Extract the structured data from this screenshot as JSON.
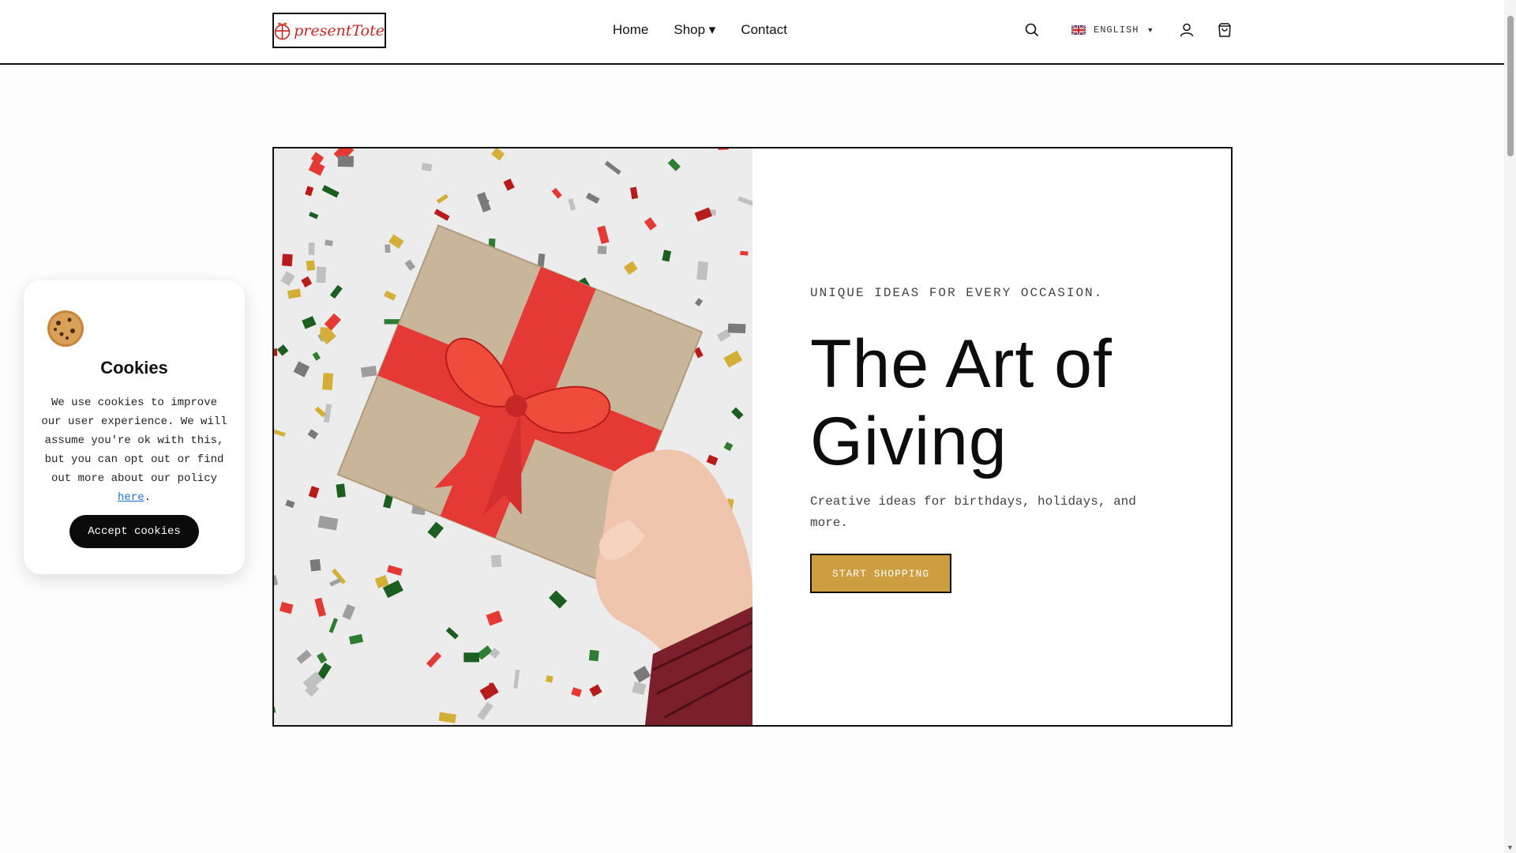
{
  "header": {
    "logo_text": "presentTote",
    "nav": [
      {
        "label": "Home"
      },
      {
        "label": "Shop ▾"
      },
      {
        "label": "Contact"
      }
    ],
    "language": "ENGLISH"
  },
  "hero": {
    "eyebrow": "UNIQUE IDEAS FOR EVERY OCCASION.",
    "title": "The Art of Giving",
    "subtitle": "Creative ideas for birthdays, holidays, and more.",
    "cta_label": "START SHOPPING"
  },
  "cookie": {
    "title": "Cookies",
    "text": "We use cookies to improve our user experience. We will assume you're ok with this, but you can opt out or find out more about our policy ",
    "link_label": "here",
    "text_end": ".",
    "button_label": "Accept cookies"
  },
  "colors": {
    "accent": "#cc9e3f",
    "logo_red": "#c62828",
    "ribbon_red": "#e53935",
    "link": "#1e6fd0"
  },
  "icons": [
    "gift-logo-icon",
    "search-icon",
    "uk-flag-icon",
    "caret-down-icon",
    "user-icon",
    "shopping-bag-icon",
    "cookie-icon"
  ]
}
